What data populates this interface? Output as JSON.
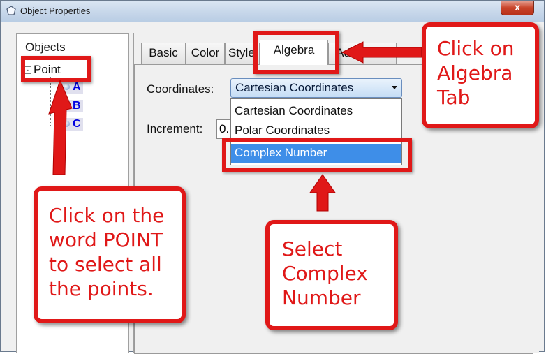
{
  "window": {
    "title": "Object Properties",
    "close_label": "x"
  },
  "objects_panel": {
    "header": "Objects",
    "root": {
      "label": "Point",
      "expander": "-"
    },
    "children": [
      {
        "label": "A"
      },
      {
        "label": "B"
      },
      {
        "label": "C"
      }
    ]
  },
  "tabs": [
    {
      "label": "Basic"
    },
    {
      "label": "Color"
    },
    {
      "label": "Style"
    },
    {
      "label": "Algebra"
    },
    {
      "label": "Advanced"
    }
  ],
  "algebra": {
    "coordinates_label": "Coordinates:",
    "coordinates_value": "Cartesian Coordinates",
    "coordinates_options": [
      "Cartesian Coordinates",
      "Polar Coordinates",
      "Complex Number"
    ],
    "highlighted_option": "Complex Number",
    "increment_label": "Increment:",
    "increment_value": "0."
  },
  "annotations": {
    "algebra_tab": [
      "Click on",
      "Algebra",
      "Tab"
    ],
    "point": [
      "Click on the",
      "word POINT",
      "to select all",
      "the points."
    ],
    "complex": [
      "Select",
      "Complex",
      "Number"
    ]
  },
  "colors": {
    "annotation_red": "#e01818",
    "selection_blue": "#3e8ee8",
    "point_blue": "#0000e0"
  }
}
